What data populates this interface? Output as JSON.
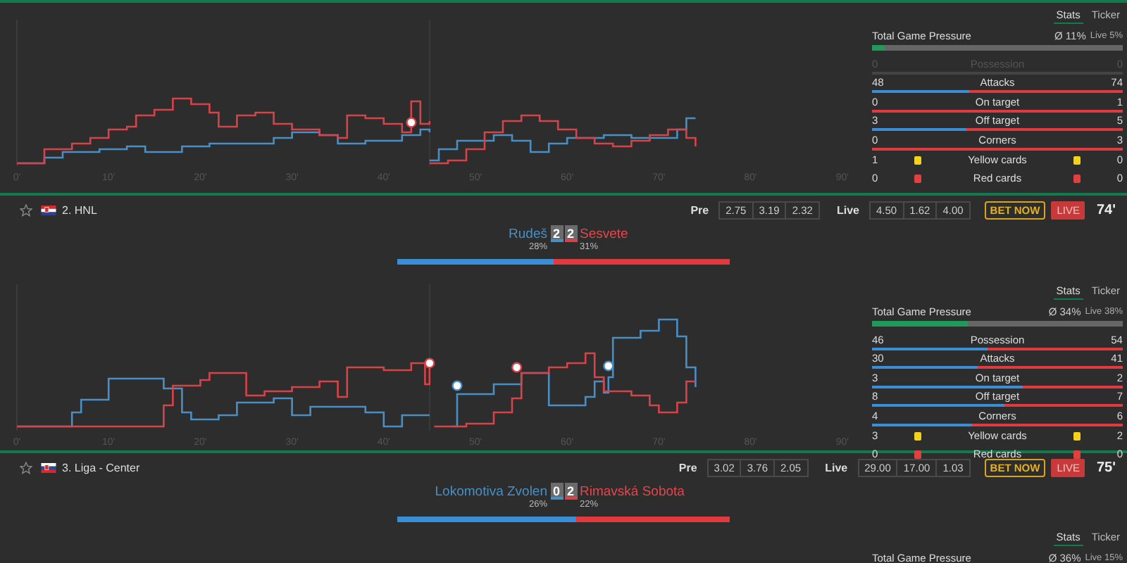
{
  "matches": [
    {
      "stats_tabs": [
        {
          "label": "Stats",
          "selected": true
        },
        {
          "label": "Ticker",
          "selected": false
        }
      ],
      "pressure": {
        "label": "Total Game Pressure",
        "average": "Ø 11%",
        "live": "Live 5%",
        "level": 0.05
      },
      "stats": [
        {
          "kind": "bar",
          "home": "0",
          "label": "Possession",
          "away": "0",
          "disabled": true
        },
        {
          "kind": "bar",
          "home": "48",
          "label": "Attacks",
          "away": "74",
          "level": 0.39,
          "disabled": false
        },
        {
          "kind": "bar",
          "home": "0",
          "label": "On target",
          "away": "1",
          "disabled": false
        },
        {
          "kind": "bar",
          "home": "3",
          "label": "Off target",
          "away": "5",
          "level": 0.375,
          "disabled": false
        },
        {
          "kind": "bar",
          "home": "0",
          "label": "Corners",
          "away": "3",
          "disabled": false
        },
        {
          "kind": "card",
          "home": "1",
          "label": "Yellow cards",
          "away": "0",
          "color": "#f2d21b"
        },
        {
          "kind": "card",
          "home": "0",
          "label": "Red cards",
          "away": "0",
          "color": "#e2403f"
        }
      ],
      "axis_labels": [
        "0'",
        "10'",
        "20'",
        "30'",
        "40'",
        "50'",
        "60'",
        "70'",
        "80'",
        "90'"
      ]
    },
    {
      "header": {
        "league": "2. HNL",
        "pre_label": "Pre",
        "pre_odds": [
          "2.75",
          "3.19",
          "2.32"
        ],
        "live_label": "Live",
        "live_odds": [
          "4.50",
          "1.62",
          "4.00"
        ],
        "bet_button": "BET NOW",
        "live_badge": "LIVE",
        "minute": "74'"
      },
      "home": {
        "name": "Rudeš",
        "score": "2",
        "share": "28%"
      },
      "away": {
        "name": "Sesvete",
        "score": "2",
        "share": "31%"
      },
      "share_bar": {
        "level": 0.47
      },
      "stats_tabs": [
        {
          "label": "Stats",
          "selected": true
        },
        {
          "label": "Ticker",
          "selected": false
        }
      ],
      "pressure": {
        "label": "Total Game Pressure",
        "average": "Ø 34%",
        "live": "Live 38%",
        "level": 0.38
      },
      "stats": [
        {
          "kind": "bar",
          "home": "46",
          "label": "Possession",
          "away": "54",
          "level": 0.46,
          "disabled": false
        },
        {
          "kind": "bar",
          "home": "30",
          "label": "Attacks",
          "away": "41",
          "level": 0.42,
          "disabled": false
        },
        {
          "kind": "bar",
          "home": "3",
          "label": "On target",
          "away": "2",
          "level": 0.6,
          "disabled": false
        },
        {
          "kind": "bar",
          "home": "8",
          "label": "Off target",
          "away": "7",
          "level": 0.53,
          "disabled": false
        },
        {
          "kind": "bar",
          "home": "4",
          "label": "Corners",
          "away": "6",
          "level": 0.4,
          "disabled": false
        },
        {
          "kind": "card",
          "home": "3",
          "label": "Yellow cards",
          "away": "2",
          "color": "#f2d21b"
        },
        {
          "kind": "card",
          "home": "0",
          "label": "Red cards",
          "away": "0",
          "color": "#e2403f"
        }
      ],
      "axis_labels": [
        "0'",
        "10'",
        "20'",
        "30'",
        "40'",
        "50'",
        "60'",
        "70'",
        "80'",
        "90'"
      ]
    },
    {
      "header": {
        "league": "3. Liga - Center",
        "pre_label": "Pre",
        "pre_odds": [
          "3.02",
          "3.76",
          "2.05"
        ],
        "live_label": "Live",
        "live_odds": [
          "29.00",
          "17.00",
          "1.03"
        ],
        "bet_button": "BET NOW",
        "live_badge": "LIVE",
        "minute": "75'"
      },
      "home": {
        "name": "Lokomotiva Zvolen",
        "score": "0",
        "share": "26%"
      },
      "away": {
        "name": "Rimavská Sobota",
        "score": "2",
        "share": "22%"
      },
      "share_bar": {
        "level": 0.54
      },
      "stats_tabs": [
        {
          "label": "Stats",
          "selected": true
        },
        {
          "label": "Ticker",
          "selected": false
        }
      ],
      "pressure": {
        "label": "Total Game Pressure",
        "average": "Ø 36%",
        "live": "Live 15%"
      }
    }
  ]
}
